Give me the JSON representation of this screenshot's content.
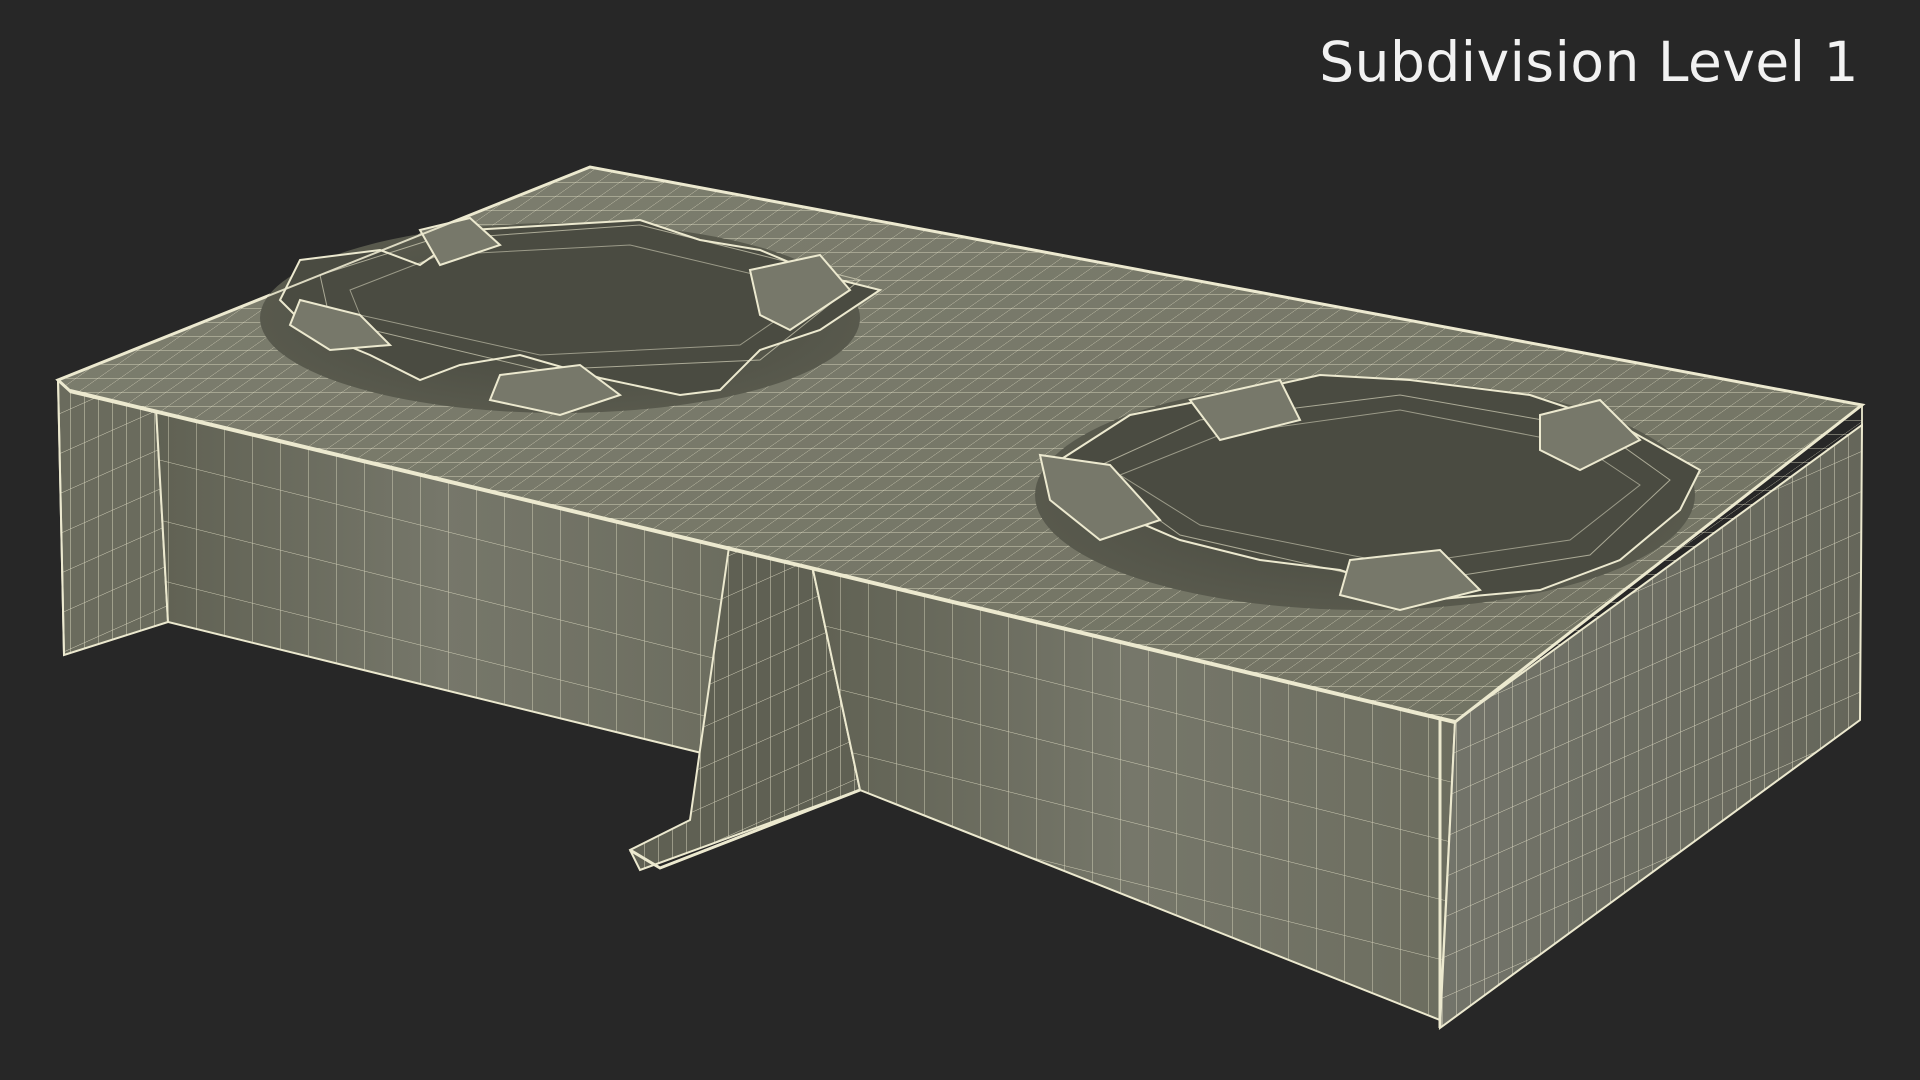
{
  "overlay": {
    "label": "Subdivision Level 1"
  },
  "render": {
    "background_color": "#272727",
    "surface_color": "#6f705f",
    "wire_color": "#ece9cf",
    "text_color": "#f2f2f2"
  }
}
